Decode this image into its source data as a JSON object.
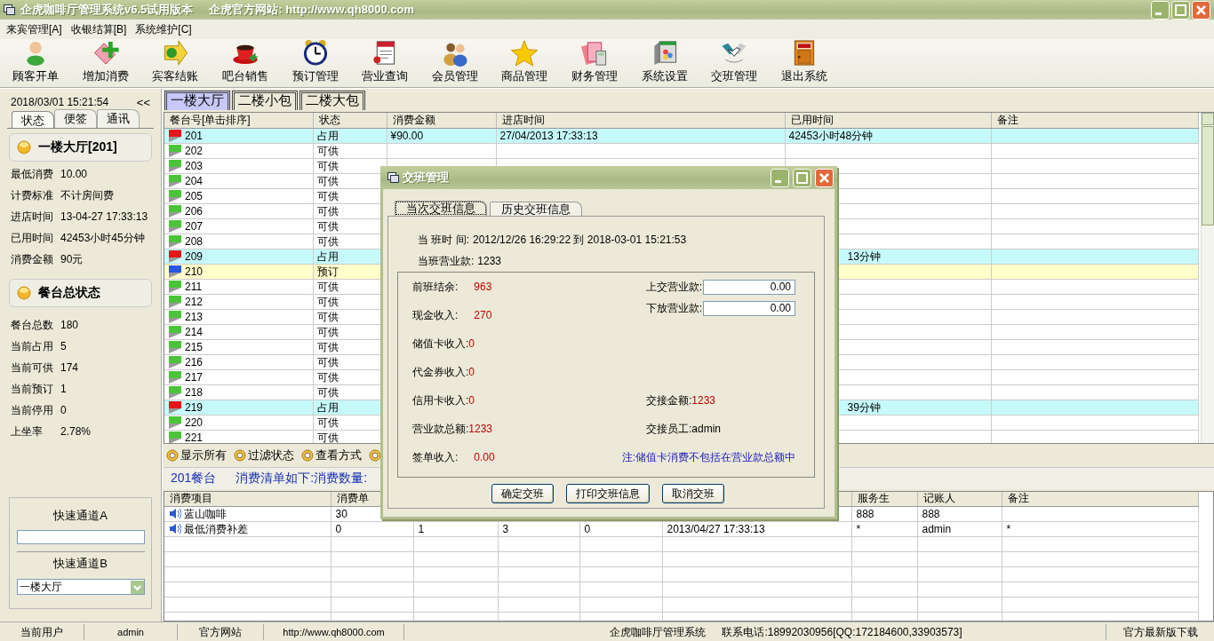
{
  "window": {
    "title": "企虎咖啡厅管理系统v6.5试用版本",
    "site": "企虎官方网站: http://www.qh8000.com"
  },
  "menu": [
    "来宾管理[A]",
    "收银结算[B]",
    "系统维护[C]"
  ],
  "toolbar": [
    {
      "label": "顾客开单"
    },
    {
      "label": "增加消费"
    },
    {
      "label": "宾客结账"
    },
    {
      "label": "吧台销售"
    },
    {
      "label": "预订管理"
    },
    {
      "label": "营业查询"
    },
    {
      "label": "会员管理"
    },
    {
      "label": "商品管理"
    },
    {
      "label": "财务管理"
    },
    {
      "label": "系统设置"
    },
    {
      "label": "交班管理"
    },
    {
      "label": "退出系统"
    }
  ],
  "side": {
    "datetime": "2018/03/01 15:21:54",
    "collapse": "<<",
    "tabs": [
      {
        "label": "状态",
        "selected": true
      },
      {
        "label": "便签",
        "selected": false
      },
      {
        "label": "通讯",
        "selected": false
      }
    ],
    "room_card": {
      "title": "一楼大厅[201]",
      "fields": [
        {
          "label": "最低消费",
          "value": "10.00"
        },
        {
          "label": "计费标准",
          "value": "不计房间费"
        },
        {
          "label": "进店时间",
          "value": "13-04-27 17:33:13"
        },
        {
          "label": "已用时间",
          "value": "42453小时45分钟"
        },
        {
          "label": "消费金额",
          "value": "90元"
        }
      ]
    },
    "summary_card": {
      "title": "餐台总状态",
      "fields": [
        {
          "label": "餐台总数",
          "value": "180"
        },
        {
          "label": "当前占用",
          "value": "5"
        },
        {
          "label": "当前可供",
          "value": "174"
        },
        {
          "label": "当前预订",
          "value": "1"
        },
        {
          "label": "当前停用",
          "value": "0"
        },
        {
          "label": "上坐率",
          "value": "2.78%"
        }
      ]
    },
    "quick": {
      "a_label": "快速通道A",
      "b_label": "快速通道B",
      "b_value": "一楼大厅"
    }
  },
  "floor_tabs": [
    {
      "label": "一楼大厅",
      "selected": true
    },
    {
      "label": "二楼小包",
      "selected": false
    },
    {
      "label": "二楼大包",
      "selected": false
    }
  ],
  "tables": {
    "columns": [
      "餐台号[单击排序]",
      "状态",
      "消费金额",
      "进店时间",
      "已用时间",
      "备注"
    ],
    "rows": [
      {
        "kind": "occupied",
        "number": "201",
        "status": "占用",
        "amount": "¥90.00",
        "arrived": "27/04/2013 17:33:13",
        "elapsed": "42453小时48分钟"
      },
      {
        "kind": "free",
        "number": "202",
        "status": "可供"
      },
      {
        "kind": "free",
        "number": "203",
        "status": "可供"
      },
      {
        "kind": "free",
        "number": "204",
        "status": "可供"
      },
      {
        "kind": "free",
        "number": "205",
        "status": "可供"
      },
      {
        "kind": "free",
        "number": "206",
        "status": "可供"
      },
      {
        "kind": "free",
        "number": "207",
        "status": "可供"
      },
      {
        "kind": "free",
        "number": "208",
        "status": "可供"
      },
      {
        "kind": "occupied",
        "number": "209",
        "status": "占用",
        "elapsed": "13分钟",
        "covered": true
      },
      {
        "kind": "reserved",
        "number": "210",
        "status": "预订"
      },
      {
        "kind": "free",
        "number": "211",
        "status": "可供"
      },
      {
        "kind": "free",
        "number": "212",
        "status": "可供"
      },
      {
        "kind": "free",
        "number": "213",
        "status": "可供"
      },
      {
        "kind": "free",
        "number": "214",
        "status": "可供"
      },
      {
        "kind": "free",
        "number": "215",
        "status": "可供"
      },
      {
        "kind": "free",
        "number": "216",
        "status": "可供"
      },
      {
        "kind": "free",
        "number": "217",
        "status": "可供"
      },
      {
        "kind": "free",
        "number": "218",
        "status": "可供"
      },
      {
        "kind": "occupied",
        "number": "219",
        "status": "占用",
        "elapsed": "39分钟",
        "covered": true
      },
      {
        "kind": "free",
        "number": "220",
        "status": "可供"
      },
      {
        "kind": "free",
        "number": "221",
        "status": "可供"
      }
    ]
  },
  "view_tools": [
    "显示所有",
    "过滤状态",
    "查看方式"
  ],
  "order_info": {
    "table": "201餐台",
    "summary": "消费清单如下:消费数量:"
  },
  "order_items": {
    "columns": [
      "消费项目",
      "消费单",
      null,
      null,
      null,
      null,
      "服务生",
      "记账人",
      "备注"
    ],
    "rows": [
      {
        "cells": [
          "蓝山咖啡",
          "30",
          null,
          null,
          null,
          null,
          "888",
          "888",
          null
        ]
      },
      {
        "cells": [
          "最低消费补差",
          "0",
          "1",
          "3",
          "0",
          "2013/04/27 17:33:13",
          "*",
          "admin",
          "*"
        ]
      }
    ]
  },
  "shift_dialog": {
    "title": "交班管理",
    "tabs": [
      {
        "label": "当次交班信息",
        "selected": true
      },
      {
        "label": "历史交班信息",
        "selected": false
      }
    ],
    "period_label": "当 班时 间:",
    "period": "2012/12/26 16:29:22 到 2018-03-01 15:21:53",
    "revenue_label": "当班营业款:",
    "revenue": "1233",
    "left_fields": [
      {
        "label": "前班结余:",
        "value": "963"
      },
      {
        "label": "现金收入:",
        "value": "270"
      },
      {
        "label": "储值卡收入:",
        "value": "0"
      },
      {
        "label": "代金券收入:",
        "value": "0"
      },
      {
        "label": "信用卡收入:",
        "value": "0"
      },
      {
        "label": "营业款总额:",
        "value": "1233"
      },
      {
        "label": "签单收入:",
        "value": "0.00"
      }
    ],
    "inputs": [
      {
        "label": "上交营业款:",
        "value": "0.00"
      },
      {
        "label": "下放营业款:",
        "value": "0.00"
      }
    ],
    "right_fields": [
      {
        "label": "交接金额:",
        "value": "1233",
        "kind": "amount"
      },
      {
        "label": "交接员工:",
        "value": "admin",
        "kind": "plain"
      }
    ],
    "note": "注:储值卡消费不包括在营业款总额中",
    "buttons": [
      "确定交班",
      "打印交班信息",
      "取消交班"
    ]
  },
  "status_bar": [
    "当前用户",
    "admin",
    "官方网站",
    "http://www.qh8000.com",
    "企虎咖啡厅管理系统",
    "联系电话:18992030956[QQ:172184600,33903573]",
    "官方最新版下载"
  ]
}
